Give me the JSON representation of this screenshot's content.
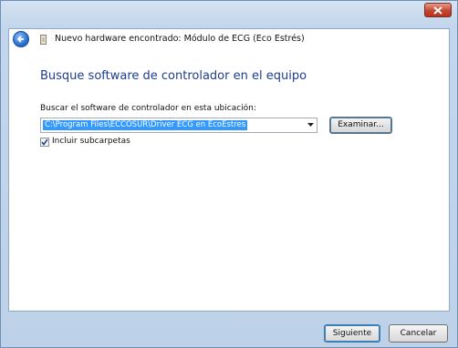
{
  "window": {
    "title": "Nuevo hardware encontrado: Módulo de ECG (Eco Estrés)"
  },
  "main": {
    "heading": "Busque software de controlador en el equipo",
    "search_label": "Buscar el software de controlador en esta ubicación:",
    "path_value": "C:\\Program Files\\ECCOSUR\\Driver ECG en EcoEstres",
    "browse_label": "Examinar...",
    "include_subfolders_label": "Incluir subcarpetas",
    "include_subfolders_checked": true
  },
  "footer": {
    "next_label": "Siguiente",
    "cancel_label": "Cancelar"
  },
  "icons": {
    "close": "close-icon",
    "back": "back-arrow-icon",
    "hardware": "hardware-icon",
    "dropdown": "chevron-down-icon",
    "check": "checkmark-icon"
  },
  "colors": {
    "heading": "#1e3d91",
    "selection": "#3399ff",
    "close_button": "#c8452f",
    "frame": "#c3d6ec"
  }
}
